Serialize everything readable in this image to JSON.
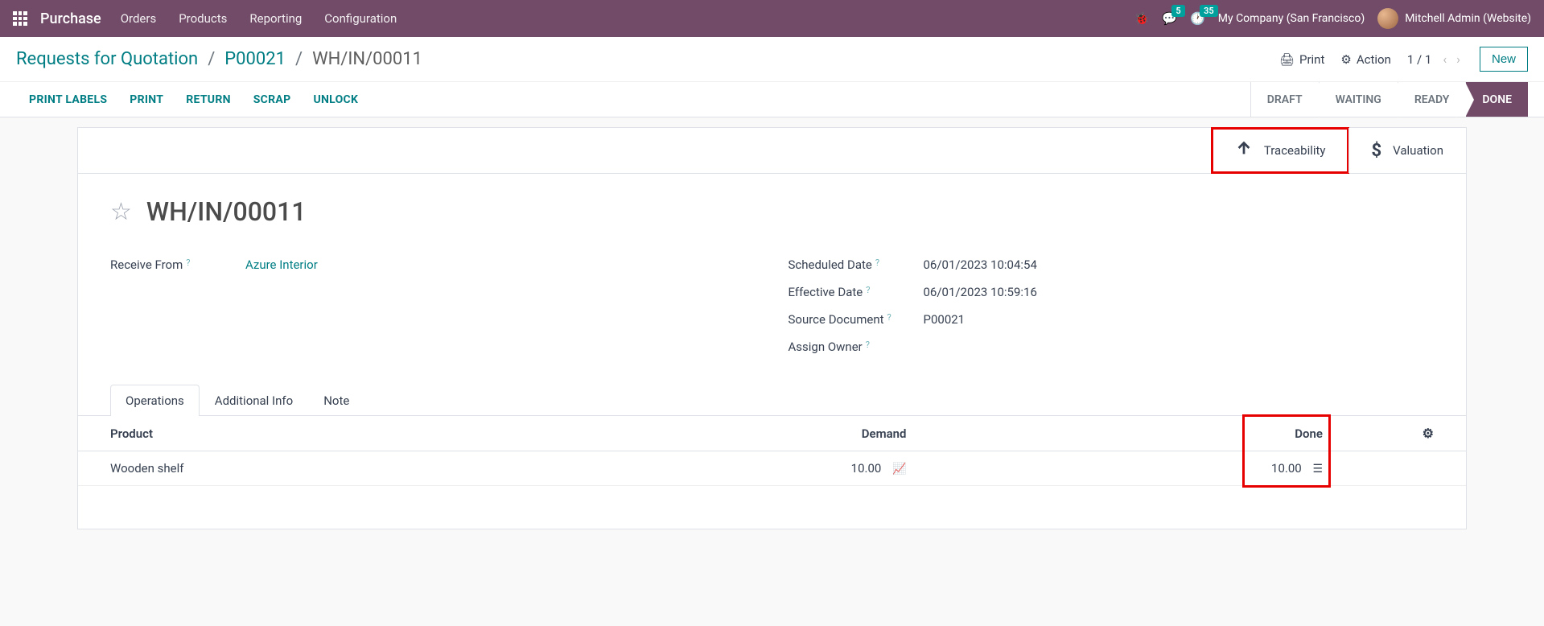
{
  "nav": {
    "brand": "Purchase",
    "menu": [
      "Orders",
      "Products",
      "Reporting",
      "Configuration"
    ],
    "chat_badge": "5",
    "clock_badge": "35",
    "company": "My Company (San Francisco)",
    "user": "Mitchell Admin (Website)"
  },
  "breadcrumb": {
    "root": "Requests for Quotation",
    "order": "P00021",
    "current": "WH/IN/00011"
  },
  "cp": {
    "print": "Print",
    "action": "Action",
    "pager": "1 / 1",
    "new": "New"
  },
  "actions": [
    "PRINT LABELS",
    "PRINT",
    "RETURN",
    "SCRAP",
    "UNLOCK"
  ],
  "statuses": [
    "DRAFT",
    "WAITING",
    "READY",
    "DONE"
  ],
  "stat_buttons": {
    "traceability": "Traceability",
    "valuation": "Valuation"
  },
  "form": {
    "title": "WH/IN/00011",
    "receive_from_label": "Receive From",
    "receive_from_value": "Azure Interior",
    "scheduled_date_label": "Scheduled Date",
    "scheduled_date_value": "06/01/2023 10:04:54",
    "effective_date_label": "Effective Date",
    "effective_date_value": "06/01/2023 10:59:16",
    "source_doc_label": "Source Document",
    "source_doc_value": "P00021",
    "assign_owner_label": "Assign Owner"
  },
  "tabs": [
    "Operations",
    "Additional Info",
    "Note"
  ],
  "table": {
    "headers": {
      "product": "Product",
      "demand": "Demand",
      "done": "Done"
    },
    "rows": [
      {
        "product": "Wooden shelf",
        "demand": "10.00",
        "done": "10.00"
      }
    ]
  }
}
